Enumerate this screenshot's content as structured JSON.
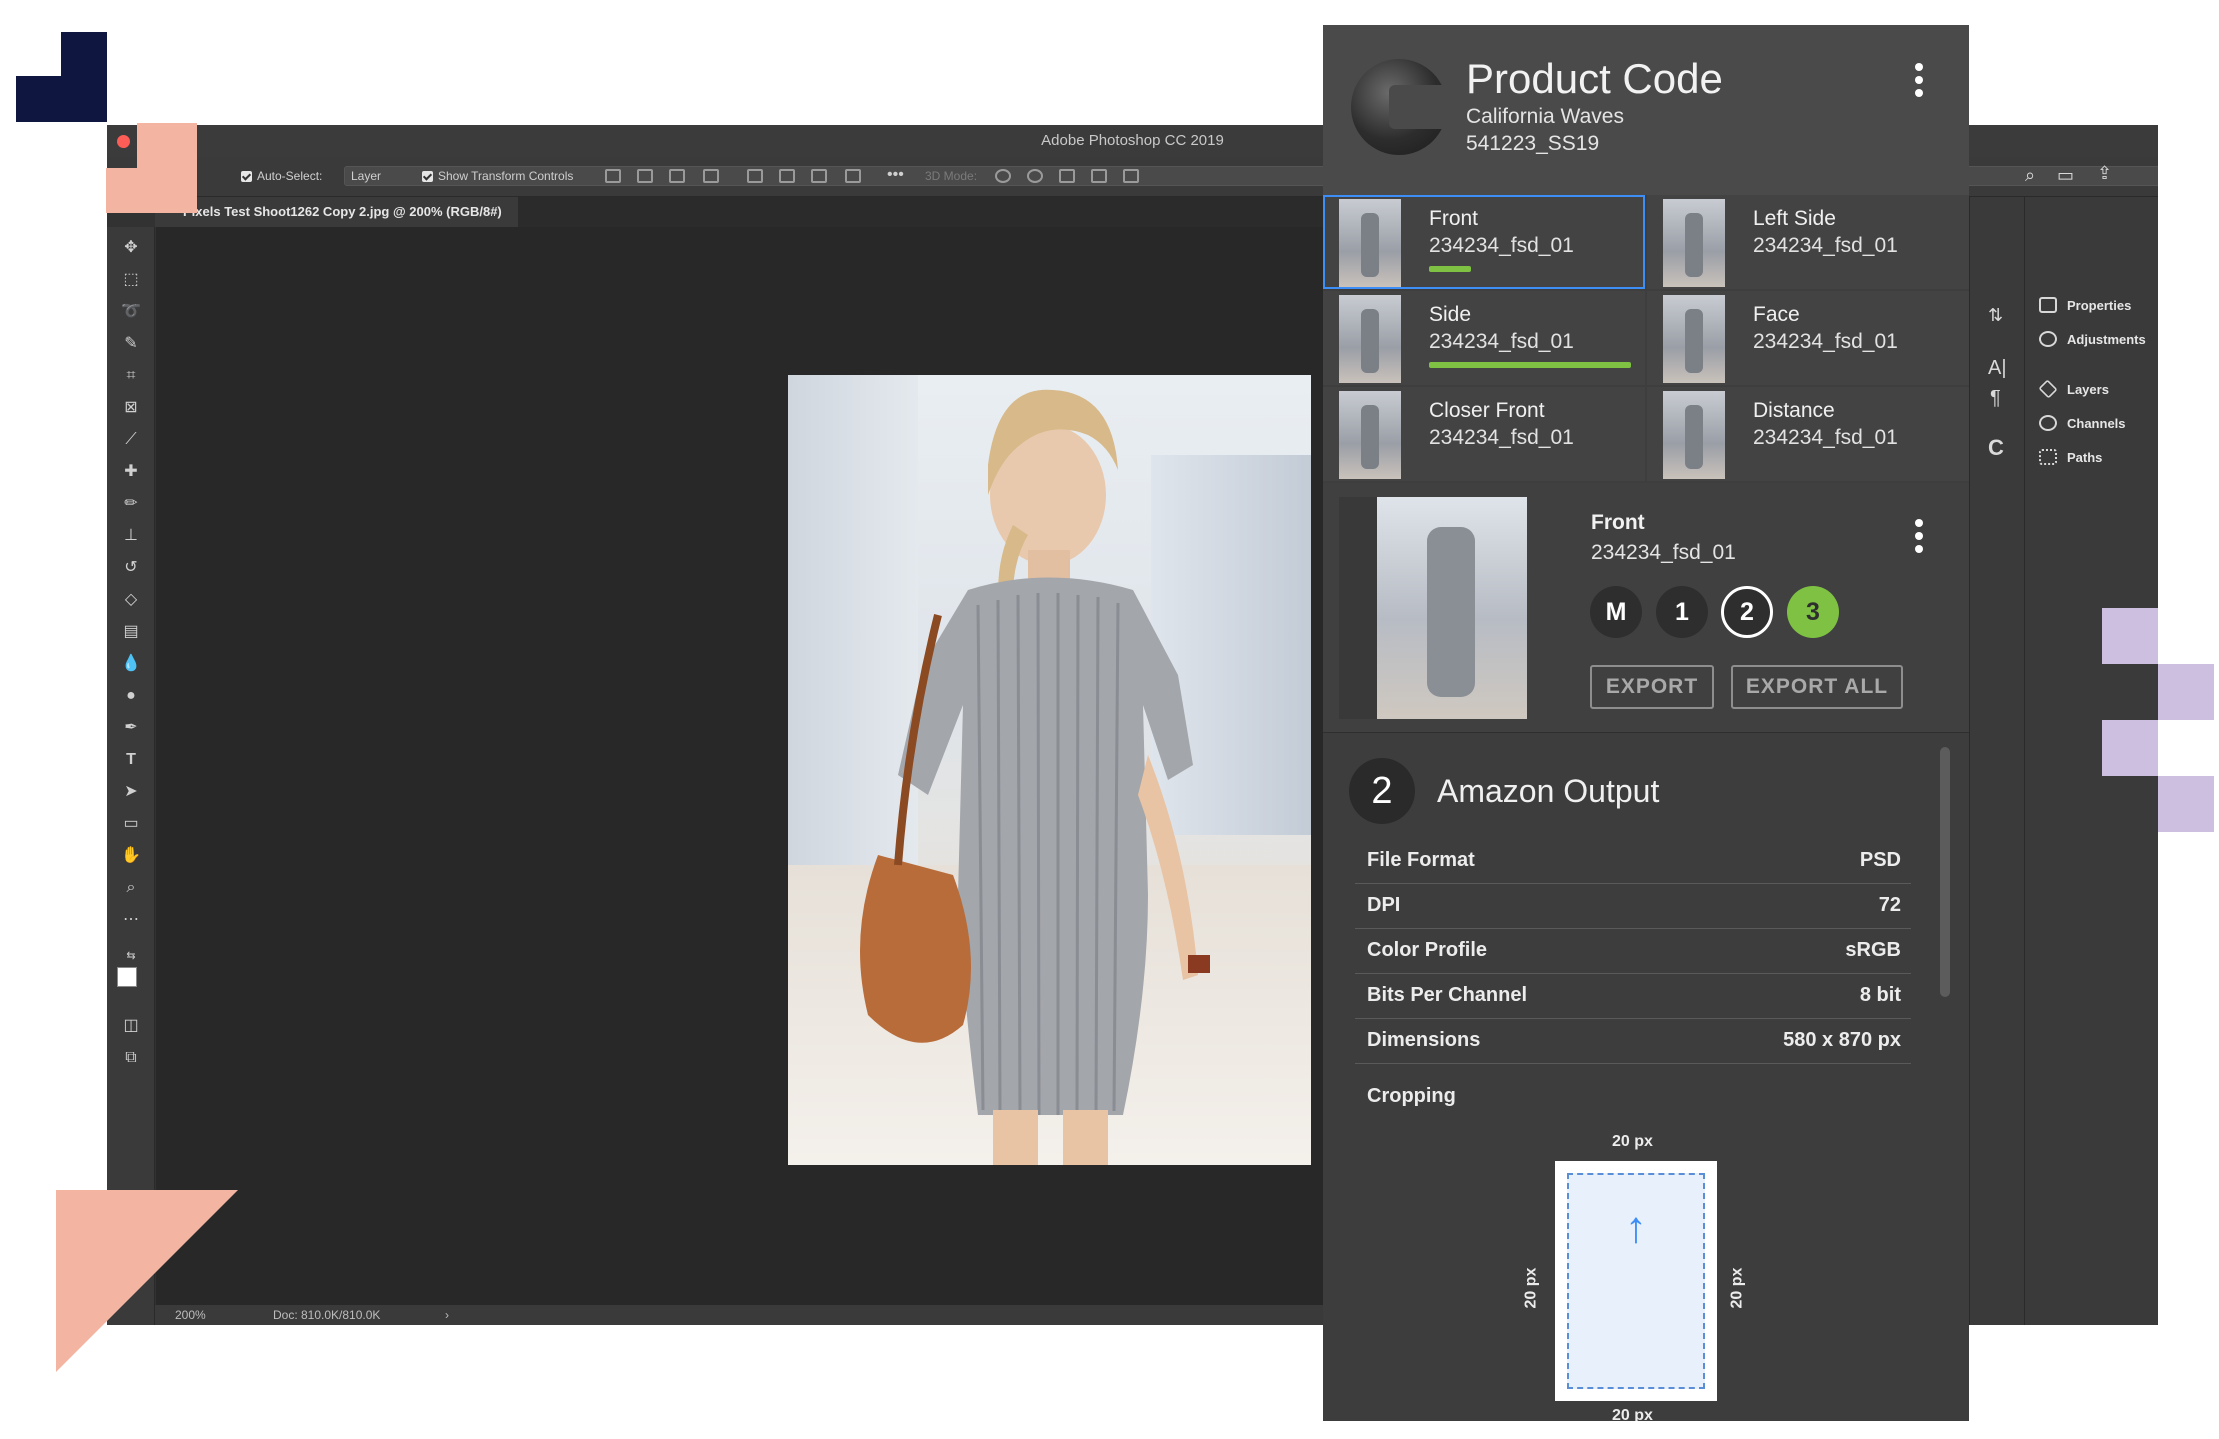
{
  "window": {
    "title": "Adobe Photoshop CC 2019",
    "doc_tab": "Pixels Test Shoot1262 Copy 2.jpg @ 200% (RGB/8#)",
    "zoom": "200%",
    "doc_size": "Doc: 810.0K/810.0K"
  },
  "options_bar": {
    "auto_select": "Auto-Select:",
    "layer": "Layer",
    "show_transform": "Show Transform Controls",
    "more": "•••",
    "mode_3d": "3D Mode:"
  },
  "right_panels": [
    "Properties",
    "Adjustments",
    "Layers",
    "Channels",
    "Paths"
  ],
  "plugin": {
    "title": "Product Code",
    "subtitle": "California Waves",
    "code": "541223_SS19",
    "views": [
      {
        "name": "Front",
        "code": "234234_fsd_01",
        "progress": 0.2
      },
      {
        "name": "Left Side",
        "code": "234234_fsd_01"
      },
      {
        "name": "Side",
        "code": "234234_fsd_01",
        "progress": 1.0
      },
      {
        "name": "Face",
        "code": "234234_fsd_01"
      },
      {
        "name": "Closer Front",
        "code": "234234_fsd_01"
      },
      {
        "name": "Distance",
        "code": "234234_fsd_01"
      }
    ],
    "detail": {
      "name": "Front",
      "code": "234234_fsd_01",
      "options": [
        "M",
        "1",
        "2",
        "3"
      ],
      "export": "EXPORT",
      "export_all": "EXPORT ALL"
    },
    "output": {
      "number": "2",
      "title": "Amazon Output",
      "rows": [
        {
          "key": "File Format",
          "value": "PSD"
        },
        {
          "key": "DPI",
          "value": "72"
        },
        {
          "key": "Color Profile",
          "value": "sRGB"
        },
        {
          "key": "Bits Per Channel",
          "value": "8 bit"
        },
        {
          "key": "Dimensions",
          "value": "580 x 870 px"
        }
      ],
      "cropping": "Cropping",
      "crop_top": "20 px",
      "crop_left": "20 px",
      "crop_right": "20 px",
      "crop_bottom": "20 px",
      "crop_arrow": "↑"
    }
  },
  "colors": {
    "accent_green": "#7ec143",
    "select_blue": "#3e8ef7",
    "navy": "#0f1640",
    "peach": "#f3b5a2",
    "lavender": "#cdbfe0"
  }
}
